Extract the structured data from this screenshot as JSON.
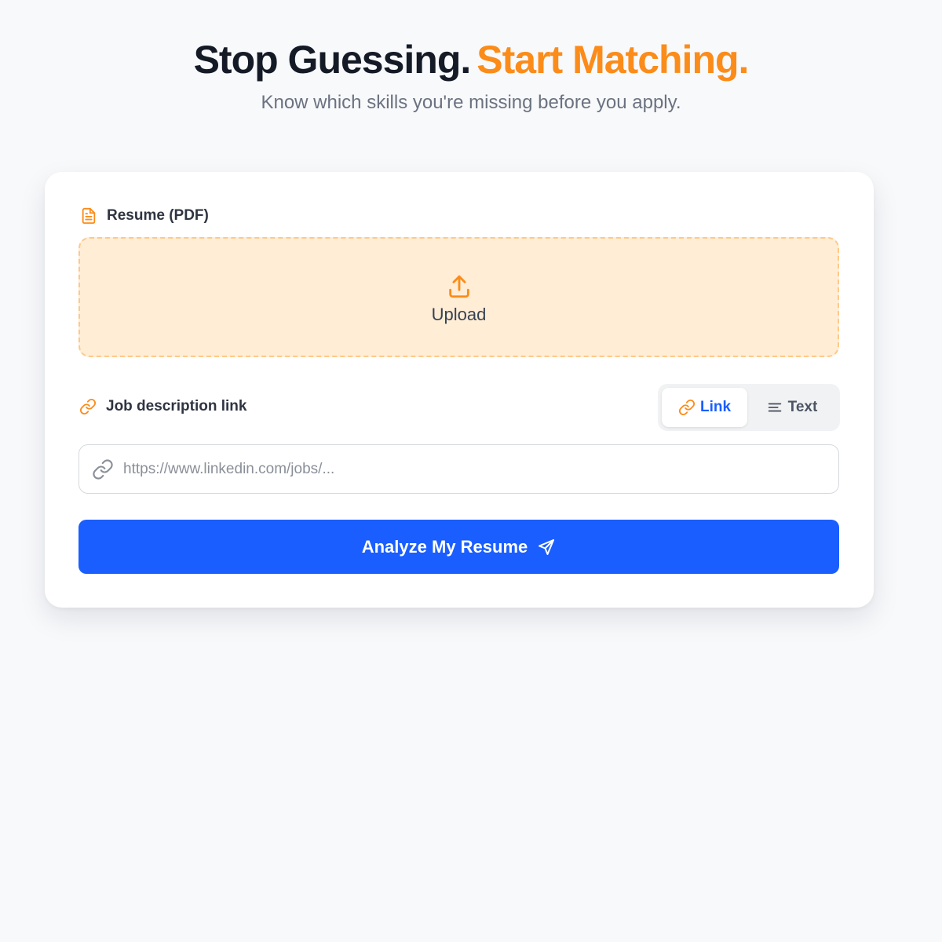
{
  "hero": {
    "title_part1": "Stop Guessing.",
    "title_part2": "Start Matching.",
    "subtitle": "Know which skills you're missing before you apply."
  },
  "resume": {
    "label": "Resume (PDF)",
    "icon": "file-text-icon",
    "upload_label": "Upload",
    "upload_icon": "upload-icon"
  },
  "job": {
    "label": "Job description link",
    "icon": "link-icon",
    "mode_options": [
      {
        "label": "Link",
        "icon": "link-icon",
        "selected": true
      },
      {
        "label": "Text",
        "icon": "align-left-icon",
        "selected": false
      }
    ],
    "url_value": "",
    "url_placeholder": "https://www.linkedin.com/jobs/..."
  },
  "actions": {
    "analyze_label": "Analyze My Resume",
    "analyze_icon": "send-icon"
  },
  "colors": {
    "accent_orange": "#fb8c1a",
    "primary_blue": "#1a5eff",
    "dropzone_bg": "#ffedd5",
    "page_bg": "#f8f9fb"
  }
}
